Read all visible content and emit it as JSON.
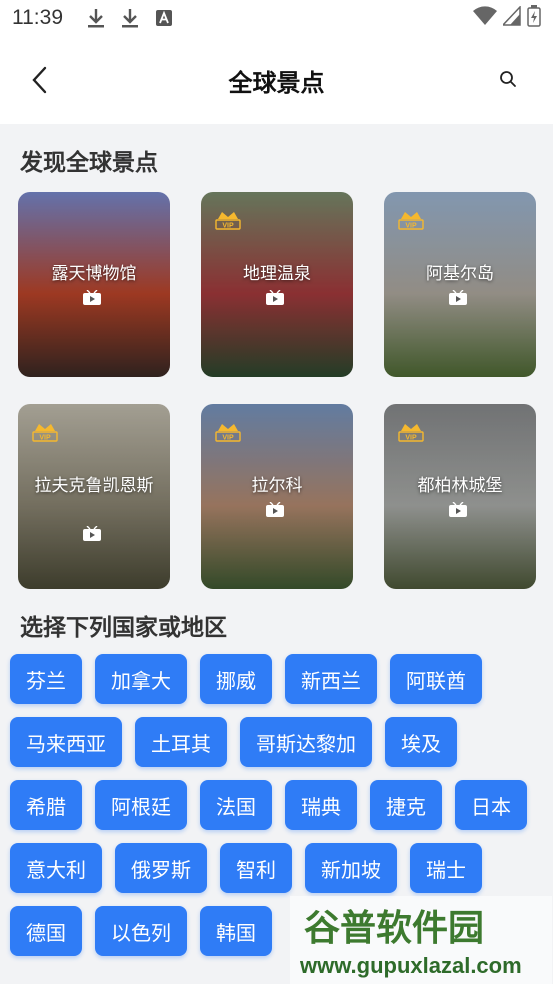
{
  "status_bar": {
    "time": "11:39",
    "icons": [
      "download-icon",
      "download-icon",
      "font-icon"
    ],
    "right_icons": [
      "wifi-icon",
      "signal-icon",
      "battery-icon"
    ]
  },
  "header": {
    "title": "全球景点",
    "back_icon": "chevron-left-icon",
    "search_icon": "search-icon"
  },
  "discover": {
    "title": "发现全球景点",
    "cards": [
      {
        "label": "露天博物馆",
        "vip": false,
        "colors": [
          "#7a8bd1",
          "#c0462a",
          "#3a2a25"
        ]
      },
      {
        "label": "地理温泉",
        "vip": true,
        "colors": [
          "#7c8f6f",
          "#a93b3e",
          "#2c4a2f"
        ]
      },
      {
        "label": "阿基尔岛",
        "vip": true,
        "colors": [
          "#9fb8d6",
          "#b2aca2",
          "#4f6b34"
        ]
      },
      {
        "label": "拉夫克鲁凯恩斯",
        "vip": true,
        "colors": [
          "#c7c2b3",
          "#8d8774",
          "#4b4a36"
        ]
      },
      {
        "label": "拉尔科",
        "vip": true,
        "colors": [
          "#7897c4",
          "#b88d72",
          "#3f5a32"
        ]
      },
      {
        "label": "都柏林城堡",
        "vip": true,
        "colors": [
          "#8a8c8e",
          "#aeb0ad",
          "#4f5a3a"
        ]
      }
    ]
  },
  "regions": {
    "title": "选择下列国家或地区",
    "rows": [
      [
        "芬兰",
        "加拿大",
        "挪威",
        "新西兰",
        "阿联酋"
      ],
      [
        "马来西亚",
        "土耳其",
        "哥斯达黎加",
        "埃及"
      ],
      [
        "希腊",
        "阿根廷",
        "法国",
        "瑞典",
        "捷克",
        "日本"
      ],
      [
        "意大利",
        "俄罗斯",
        "智利",
        "新加坡",
        "瑞士"
      ],
      [
        "德国",
        "以色列",
        "韩国"
      ]
    ]
  },
  "watermark": {
    "brand": "谷普软件园",
    "url": "www.gupuxlazal.com"
  },
  "colors": {
    "accent": "#2f7cf6",
    "background": "#f2f3f5"
  }
}
